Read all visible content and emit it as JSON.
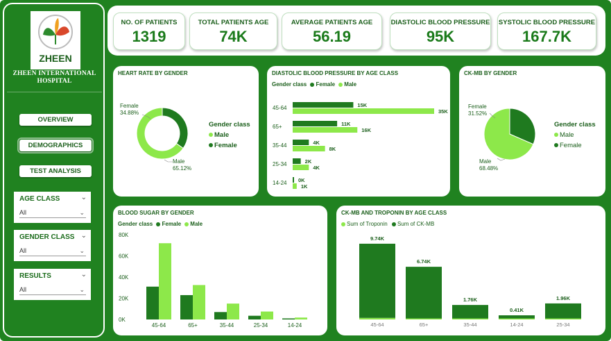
{
  "colors": {
    "dark_green": "#1f7a1f",
    "light_green": "#8de84a",
    "frame": "#208220"
  },
  "sidebar": {
    "logo_text": "ZHEEN",
    "hospital_name": "ZHEEN INTERNATIONAL HOSPITAL",
    "nav": [
      "OVERVIEW",
      "DEMOGRAPHICS",
      "TEST ANALYSIS"
    ],
    "slicers": [
      {
        "title": "AGE CLASS",
        "value": "All"
      },
      {
        "title": "GENDER CLASS",
        "value": "All"
      },
      {
        "title": "RESULTS",
        "value": "All"
      }
    ]
  },
  "kpis": [
    {
      "title": "NO. OF PATIENTS",
      "value": "1319"
    },
    {
      "title": "TOTAL PATIENTS AGE",
      "value": "74K"
    },
    {
      "title": "AVERAGE PATIENTS AGE",
      "value": "56.19"
    },
    {
      "title": "DIASTOLIC BLOOD PRESSURE",
      "value": "95K"
    },
    {
      "title": "SYSTOLIC BLOOD PRESSURE",
      "value": "167.7K"
    }
  ],
  "panels": {
    "heart_rate": {
      "title": "HEART RATE BY GENDER",
      "legend_title": "Gender class",
      "legend": [
        "Male",
        "Female"
      ],
      "female_label": "Female",
      "female_pct": "34.88%",
      "male_label": "Male",
      "male_pct": "65.12%"
    },
    "diastolic": {
      "title": "DIASTOLIC BLOOD PRESSURE BY AGE CLASS",
      "legend_title": "Gender class",
      "legend": [
        "Female",
        "Male"
      ]
    },
    "ckmb": {
      "title": "CK-MB BY GENDER",
      "legend_title": "Gender class",
      "legend": [
        "Male",
        "Female"
      ],
      "female_label": "Female",
      "female_pct": "31.52%",
      "male_label": "Male",
      "male_pct": "68.48%"
    },
    "blood_sugar": {
      "title": "BLOOD SUGAR BY GENDER",
      "legend_title": "Gender class",
      "legend": [
        "Female",
        "Male"
      ]
    },
    "ckmb_troponin": {
      "title": "CK-MB AND TROPONIN BY AGE CLASS",
      "legend": [
        "Sum of Troponin",
        "Sum of CK-MB"
      ]
    }
  },
  "chart_data": [
    {
      "type": "pie",
      "categories": [
        "Female",
        "Male"
      ],
      "values": [
        34.88,
        65.12
      ],
      "value_labels": [
        "34.88%",
        "65.12%"
      ],
      "donut": true,
      "title": "HEART RATE BY GENDER",
      "legend_title": "Gender class",
      "legend_position": "right"
    },
    {
      "type": "bar",
      "orientation": "horizontal",
      "title": "DIASTOLIC BLOOD PRESSURE BY AGE CLASS",
      "legend_title": "Gender class",
      "legend_position": "top-left",
      "categories": [
        "45-64",
        "65+",
        "35-44",
        "25-34",
        "14-24"
      ],
      "series": [
        {
          "name": "Female",
          "values": [
            15,
            11,
            4,
            2,
            0
          ],
          "labels": [
            "15K",
            "11K",
            "4K",
            "2K",
            "0K"
          ]
        },
        {
          "name": "Male",
          "values": [
            35,
            16,
            8,
            4,
            1
          ],
          "labels": [
            "35K",
            "16K",
            "8K",
            "4K",
            "1K"
          ]
        }
      ],
      "xlim": [
        0,
        35
      ]
    },
    {
      "type": "pie",
      "categories": [
        "Female",
        "Male"
      ],
      "values": [
        31.52,
        68.48
      ],
      "value_labels": [
        "31.52%",
        "68.48%"
      ],
      "title": "CK-MB BY GENDER",
      "legend_title": "Gender class",
      "legend_position": "right"
    },
    {
      "type": "bar",
      "title": "BLOOD SUGAR BY GENDER",
      "legend_title": "Gender class",
      "legend_position": "top-left",
      "categories": [
        "45-64",
        "65+",
        "35-44",
        "25-34",
        "14-24"
      ],
      "series": [
        {
          "name": "Female",
          "values": [
            31000,
            23000,
            7000,
            3500,
            1000
          ]
        },
        {
          "name": "Male",
          "values": [
            72000,
            32500,
            15000,
            7500,
            1800
          ]
        }
      ],
      "ylim": [
        0,
        80000
      ],
      "yticks": [
        "0K",
        "20K",
        "40K",
        "60K",
        "80K"
      ],
      "grid": false
    },
    {
      "type": "bar",
      "stacked": true,
      "title": "CK-MB AND TROPONIN BY AGE CLASS",
      "legend_position": "top-left",
      "categories": [
        "45-64",
        "65+",
        "35-44",
        "14-24",
        "25-34"
      ],
      "series": [
        {
          "name": "Sum of Troponin",
          "values": [
            0.2,
            0.1,
            0.03,
            0.01,
            0.03
          ]
        },
        {
          "name": "Sum of CK-MB",
          "values": [
            9.54,
            6.64,
            1.73,
            0.4,
            1.93
          ]
        }
      ],
      "total_labels": [
        "9.74K",
        "6.74K",
        "1.76K",
        "0.41K",
        "1.96K"
      ],
      "ylim": [
        0,
        10
      ]
    }
  ]
}
